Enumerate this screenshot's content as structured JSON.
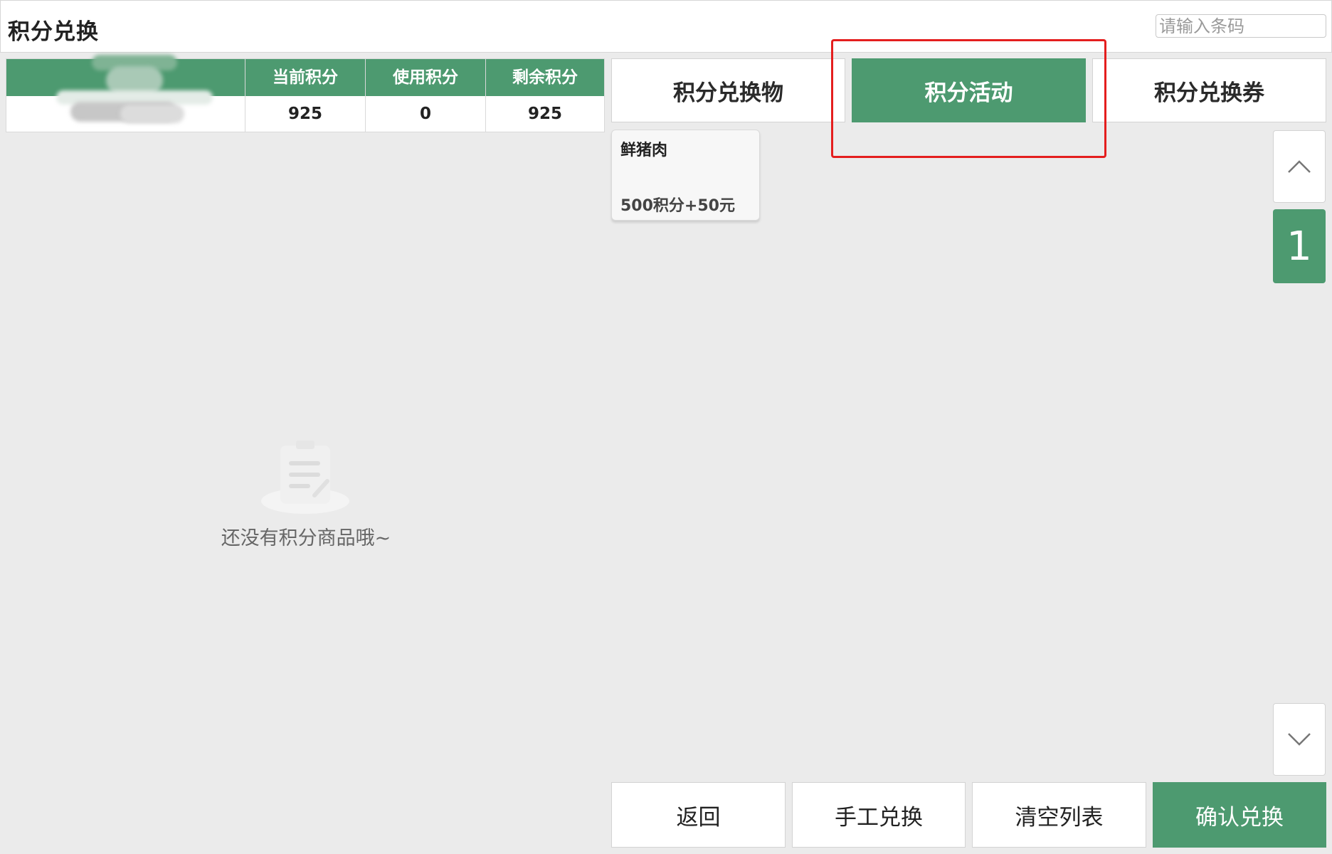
{
  "header": {
    "title": "积分兑换",
    "barcode_placeholder": "请输入条码"
  },
  "points": {
    "headers": [
      "当前积分",
      "使用积分",
      "剩余积分"
    ],
    "values": [
      "925",
      "0",
      "925"
    ]
  },
  "tabs": [
    {
      "label": "积分兑换物",
      "active": false
    },
    {
      "label": "积分活动",
      "active": true
    },
    {
      "label": "积分兑换券",
      "active": false
    }
  ],
  "products": [
    {
      "name": "鲜猪肉",
      "price": "500积分+50元"
    }
  ],
  "pager": {
    "current_page": "1"
  },
  "empty_state": {
    "text": "还没有积分商品哦~"
  },
  "actions": {
    "back": "返回",
    "manual": "手工兑换",
    "clear": "清空列表",
    "confirm": "确认兑换"
  },
  "colors": {
    "accent": "#4d9a70",
    "highlight": "#e41e1e",
    "background": "#ebebeb"
  }
}
